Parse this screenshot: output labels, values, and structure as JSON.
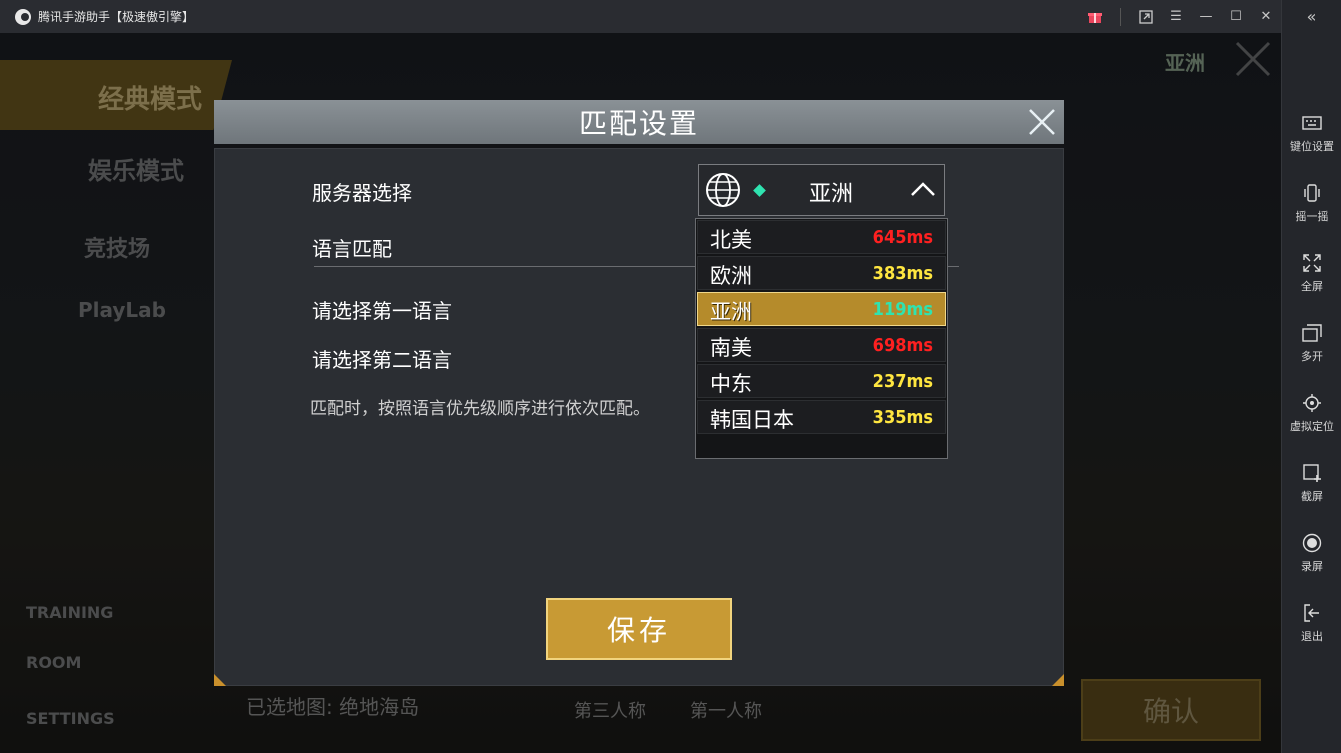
{
  "app": {
    "title": "腾讯手游助手【极速傲引擎】"
  },
  "sidebar": {
    "items": [
      {
        "label": "键位设置",
        "icon": "keyboard-icon"
      },
      {
        "label": "摇一摇",
        "icon": "shake-icon"
      },
      {
        "label": "全屏",
        "icon": "fullscreen-icon"
      },
      {
        "label": "多开",
        "icon": "multi-window-icon"
      },
      {
        "label": "虚拟定位",
        "icon": "location-icon"
      },
      {
        "label": "截屏",
        "icon": "screenshot-icon"
      },
      {
        "label": "录屏",
        "icon": "record-icon"
      },
      {
        "label": "退出",
        "icon": "exit-icon"
      }
    ]
  },
  "game": {
    "modes": [
      "经典模式",
      "娱乐模式",
      "竞技场",
      "PlayLab"
    ],
    "region_label": "亚洲",
    "left_menu": [
      "TRAINING",
      "ROOM",
      "SETTINGS"
    ],
    "map_label": "已选地图: 绝地海岛",
    "perspective": [
      "第三人称",
      "第一人称"
    ],
    "confirm_label": "确认"
  },
  "dialog": {
    "title": "匹配设置",
    "server_label": "服务器选择",
    "language_match_label": "语言匹配",
    "first_language_label": "请选择第一语言",
    "second_language_label": "请选择第二语言",
    "hint": "匹配时，按照语言优先级顺序进行依次匹配。",
    "selected_server": "亚洲",
    "save_label": "保存",
    "servers": [
      {
        "name": "北美",
        "ping": "645ms",
        "color": "#ff2020"
      },
      {
        "name": "欧洲",
        "ping": "383ms",
        "color": "#ffe640"
      },
      {
        "name": "亚洲",
        "ping": "119ms",
        "color": "#2fe3b0",
        "selected": true
      },
      {
        "name": "南美",
        "ping": "698ms",
        "color": "#ff2020"
      },
      {
        "name": "中东",
        "ping": "237ms",
        "color": "#ffe640"
      },
      {
        "name": "韩国日本",
        "ping": "335ms",
        "color": "#ffe640"
      }
    ]
  },
  "colors": {
    "accent_gold": "#c89a34",
    "ping_good": "#2fe3b0",
    "ping_ok": "#ffe640",
    "ping_bad": "#ff2020"
  }
}
